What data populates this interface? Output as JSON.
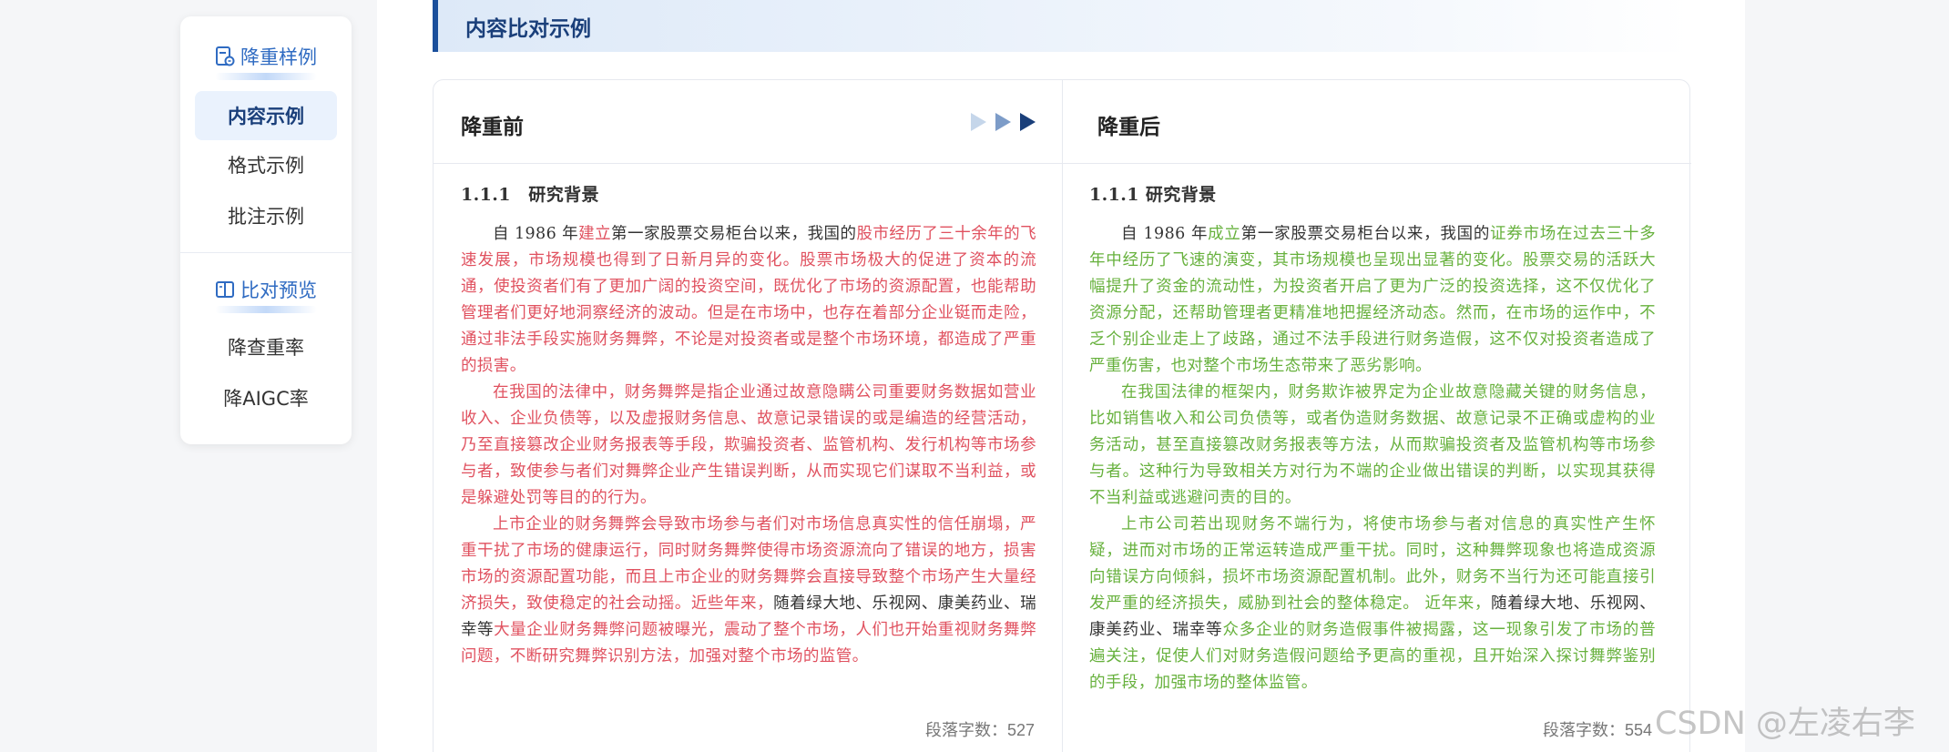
{
  "sidebar": {
    "group1_label": "降重样例",
    "group1_icon": "document-edit-icon",
    "items1": [
      "内容示例",
      "格式示例",
      "批注示例"
    ],
    "group2_label": "比对预览",
    "group2_icon": "book-compare-icon",
    "items2": [
      "降查重率",
      "降AIGC率"
    ],
    "accent_color": "#2f6bc2"
  },
  "banner": {
    "title": "内容比对示例"
  },
  "compare": {
    "before": {
      "title": "降重前",
      "heading": "1.1.1　研究背景",
      "p1": [
        {
          "t": "自 1986 年",
          "c": "plain"
        },
        {
          "t": "建立",
          "c": "red"
        },
        {
          "t": "第一家股票交易柜台以来，我国的",
          "c": "plain"
        },
        {
          "t": "股市经历了三十余年的飞速发展，市场规模也得到了日新月异的变化。股票市场极大的促进了资本的流通，使投资者们有了更加广阔的投资空间，既优化了市场的资源配置，也能帮助管理者们更好地洞察经济的波动。但是在市场中，也存在着部分企业铤而走险，通过非法手段实施财务舞弊，不论是对投资者或是整个市场环境，都造成了严重的损害。",
          "c": "red"
        }
      ],
      "p2": "在我国的法律中，财务舞弊是指企业通过故意隐瞒公司重要财务数据如营业收入、企业负债等，以及虚报财务信息、故意记录错误的或是编造的经营活动，乃至直接篡改企业财务报表等手段，欺骗投资者、监管机构、发行机构等市场参与者，致使参与者们对舞弊企业产生错误判断，从而实现它们谋取不当利益，或是躲避处罚等目的的行为。",
      "p3": [
        {
          "t": "上市企业的财务舞弊会导致市场参与者们对市场信息真实性的信任崩塌，严重干扰了市场的健康运行，同时财务舞弊使得市场资源流向了错误的地方，损害市场的资源配置功能，而且上市企业的财务舞弊会直接导致整个市场产生大量经济损失，致使稳定的社会动摇。近些年来，",
          "c": "red"
        },
        {
          "t": "随着绿大地、乐视网、康美药业、瑞幸等",
          "c": "plain"
        },
        {
          "t": "大量企业财务舞弊问题被曝光，震动了整个市场，人们也开始重视财务舞弊问题，不断研究舞弊识别方法，加强对整个市场的监管。",
          "c": "red"
        }
      ],
      "word_count": "段落字数：527"
    },
    "after": {
      "title": "降重后",
      "heading": "1.1.1 研究背景",
      "p1": [
        {
          "t": "自 1986 年",
          "c": "plain"
        },
        {
          "t": "成立",
          "c": "green"
        },
        {
          "t": "第一家股票交易柜台以来，我国的",
          "c": "plain"
        },
        {
          "t": "证券市场在过去三十多年中经历了飞速的演变，其市场规模也呈现出显著的变化。股票交易的活跃大幅提升了资金的流动性，为投资者开启了更为广泛的投资选择，这不仅优化了资源分配，还帮助管理者更精准地把握经济动态。然而，在市场的运作中，不乏个别企业走上了歧路，通过不法手段进行财务造假，这不仅对投资者造成了严重伤害，也对整个市场生态带来了恶劣影响。",
          "c": "green"
        }
      ],
      "p2": "在我国法律的框架内，财务欺诈被界定为企业故意隐藏关键的财务信息，比如销售收入和公司负债等，或者伪造财务数据、故意记录不正确或虚构的业务活动，甚至直接篡改财务报表等方法，从而欺骗投资者及监管机构等市场参与者。这种行为导致相关方对行为不端的企业做出错误的判断，以实现其获得不当利益或逃避问责的目的。",
      "p3": [
        {
          "t": "上市公司若出现财务不端行为，将使市场参与者对信息的真实性产生怀疑，进而对市场的正常运转造成严重干扰。同时，这种舞弊现象也将造成资源向错误方向倾斜，损坏市场资源配置机制。此外，财务不当行为还可能直接引发严重的经济损失，威胁到社会的整体稳定。 近年来，",
          "c": "green"
        },
        {
          "t": "随着绿大地、乐视网、康美药业、瑞幸等",
          "c": "plain"
        },
        {
          "t": "众多企业的财务造假事件被揭露，这一现象引发了市场的普遍关注，促使人们对财务造假问题给予更高的重视，且开始深入探讨舞弊鉴别的手段，加强市场的整体监管。",
          "c": "green"
        }
      ],
      "word_count": "段落字数：554"
    }
  },
  "watermark": "CSDN @左凌右李",
  "colors": {
    "removed": "#e0515f",
    "rewritten": "#67b13d",
    "heading": "#1a3f7a"
  }
}
